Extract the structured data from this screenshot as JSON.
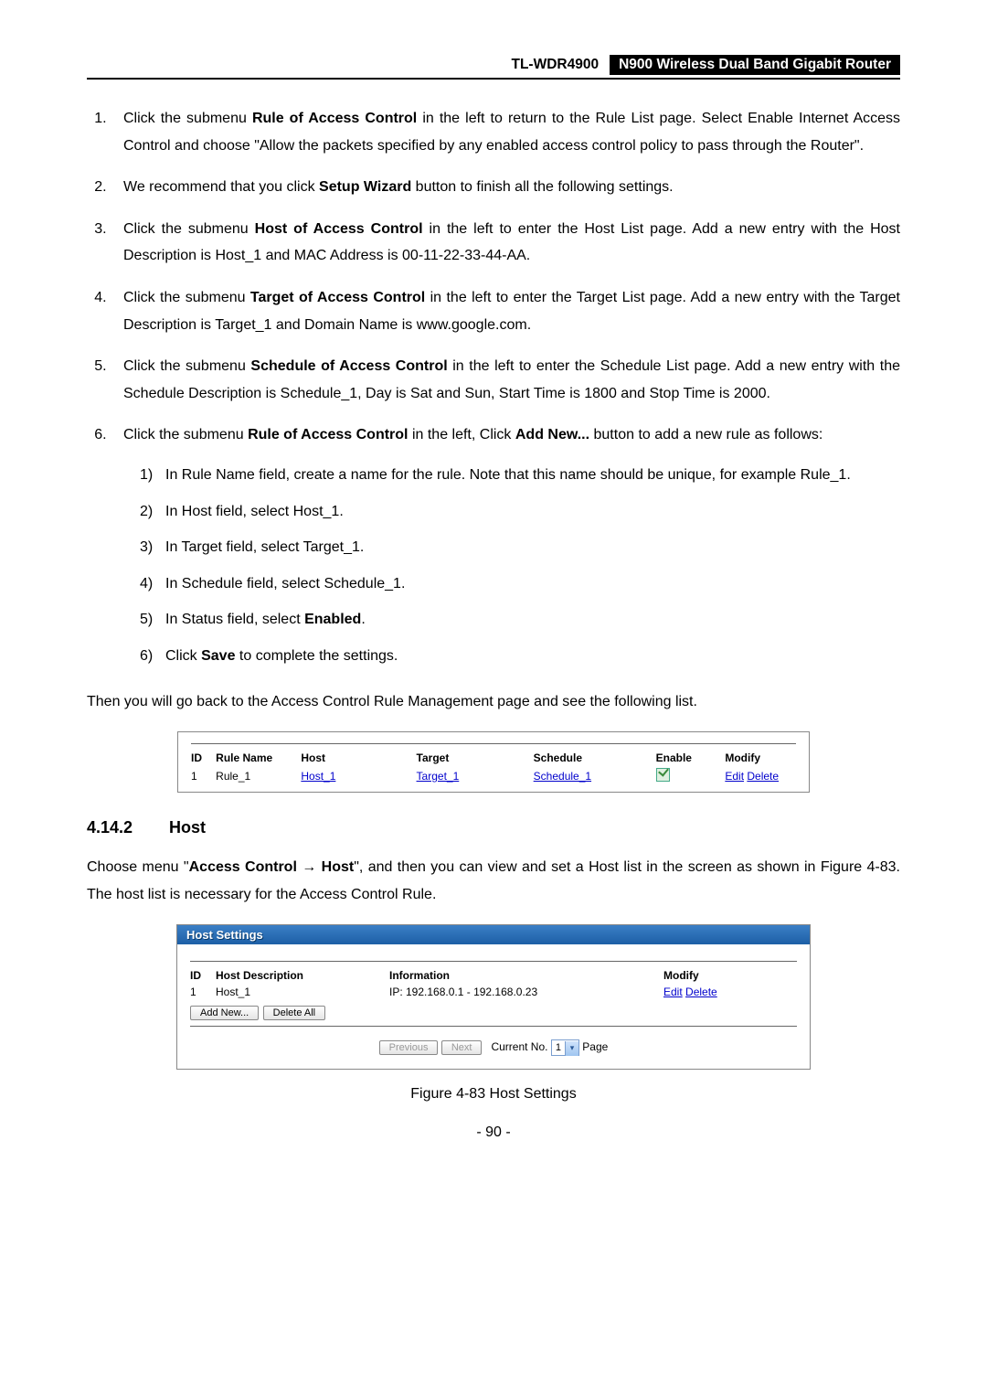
{
  "header": {
    "model": "TL-WDR4900",
    "product": "N900 Wireless Dual Band Gigabit Router"
  },
  "steps": {
    "s1a": "Click the submenu ",
    "s1b": "Rule of Access Control",
    "s1c": " in the left to return to the Rule List page. Select Enable Internet Access Control and choose \"Allow the packets specified by any enabled access control policy to pass through the Router\".",
    "s2a": "We recommend that you click ",
    "s2b": "Setup Wizard",
    "s2c": " button to finish all the following settings.",
    "s3a": "Click the submenu ",
    "s3b": "Host of Access Control",
    "s3c": " in the left to enter the Host List page. Add a new entry with the Host Description is Host_1 and MAC Address is 00-11-22-33-44-AA.",
    "s4a": "Click the submenu ",
    "s4b": "Target of Access Control",
    "s4c": " in the left to enter the Target List page. Add a new entry with the Target Description is Target_1 and Domain Name is www.google.com.",
    "s5a": "Click the submenu ",
    "s5b": "Schedule of Access Control",
    "s5c": " in the left to enter the Schedule List page. Add a new entry with the Schedule Description is Schedule_1, Day is Sat and Sun, Start Time is 1800 and Stop Time is 2000.",
    "s6a": "Click the submenu ",
    "s6b": "Rule of Access Control",
    "s6c": " in the left, Click ",
    "s6d": "Add New...",
    "s6e": " button to add a new rule as follows:"
  },
  "subs": {
    "n1": "1)",
    "n2": "2)",
    "n3": "3)",
    "n4": "4)",
    "n5": "5)",
    "n6": "6)",
    "t1": "In Rule Name field, create a name for the rule. Note that this name should be unique, for example Rule_1.",
    "t2": "In Host field, select Host_1.",
    "t3": "In Target field, select Target_1.",
    "t4": "In Schedule field, select Schedule_1.",
    "t5a": "In Status field, select ",
    "t5b": "Enabled",
    "t5c": ".",
    "t6a": "Click ",
    "t6b": "Save",
    "t6c": " to complete the settings."
  },
  "afterlist": "Then you will go back to the Access Control Rule Management page and see the following list.",
  "ruletable": {
    "head": {
      "id": "ID",
      "rulename": "Rule Name",
      "host": "Host",
      "target": "Target",
      "schedule": "Schedule",
      "enable": "Enable",
      "modify": "Modify"
    },
    "row": {
      "id": "1",
      "rulename": "Rule_1",
      "host": "Host_1",
      "target": "Target_1",
      "schedule": "Schedule_1",
      "edit": "Edit",
      "delete": "Delete"
    }
  },
  "section": {
    "num": "4.14.2",
    "title": "Host",
    "p1a": "Choose menu \"",
    "p1b": "Access Control",
    "p1arrow": " → ",
    "p1c": "Host",
    "p1d": "\", and then you can view and set a Host list in the screen as shown in Figure 4-83. The host list is necessary for the Access Control Rule."
  },
  "hostbox": {
    "title": "Host Settings",
    "head": {
      "id": "ID",
      "desc": "Host Description",
      "info": "Information",
      "modify": "Modify"
    },
    "row": {
      "id": "1",
      "desc": "Host_1",
      "info": "IP: 192.168.0.1 - 192.168.0.23",
      "edit": "Edit",
      "delete": "Delete"
    },
    "btn_add": "Add New...",
    "btn_delall": "Delete All",
    "btn_prev": "Previous",
    "btn_next": "Next",
    "pager_pre": "Current No.",
    "pager_val": "1",
    "pager_post": "Page"
  },
  "figure": "Figure 4-83 Host Settings",
  "pagenum": "- 90 -"
}
